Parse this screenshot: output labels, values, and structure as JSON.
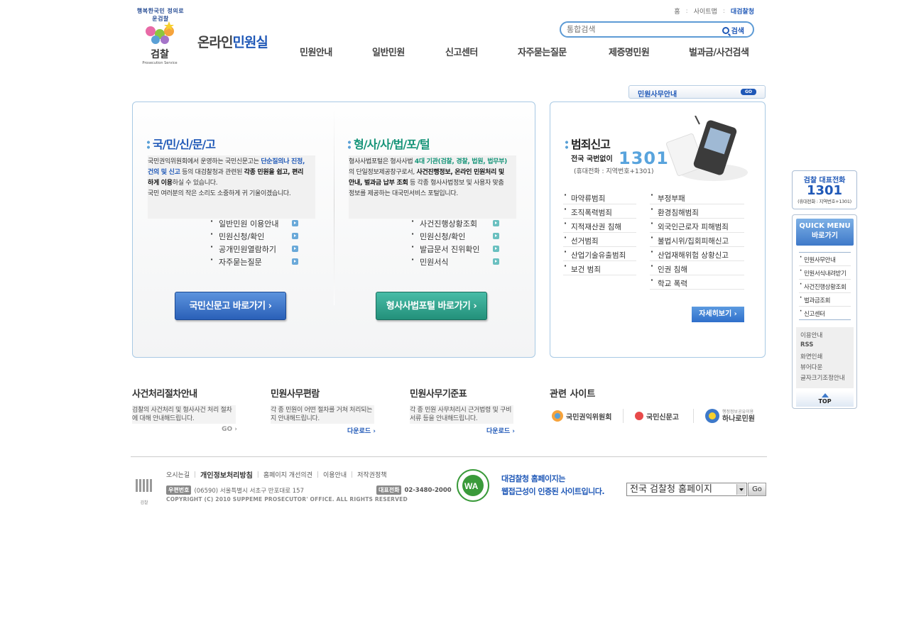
{
  "header": {
    "logo": {
      "ring_text": "행복한국민 정의로운검찰",
      "name": "검찰",
      "eng": "Prosecution Service"
    },
    "title_prefix": "온라인",
    "title_main": "민원실",
    "util": {
      "home": "홈",
      "sitemap": "사이트맵",
      "agency": "대검찰청"
    },
    "search": {
      "placeholder": "통합검색",
      "button": "검색"
    },
    "nav": [
      "민원안내",
      "일반민원",
      "신고센터",
      "자주묻는질문",
      "제증명민원",
      "벌과금/사건검색"
    ]
  },
  "office_bar": {
    "label": "민원사무안내",
    "go": "GO"
  },
  "sinmungo": {
    "title": "국/민/신/문/고",
    "desc_1": "국민권익위원회에서 운영하는 국민신문고는 ",
    "desc_hl1": "단순질의나 진정,",
    "desc_hl2": "건의 및 신고",
    "desc_2": " 등의 대검찰청과 관련된 ",
    "desc_b1": "각종 민원을 쉽고, 편리",
    "desc_b2": "하게 이용",
    "desc_3": "하실 수 있습니다.",
    "desc_4": "국민 여러분의 작은 소리도 소중하게 귀 기울이겠습니다.",
    "links": [
      "일반민원 이용안내",
      "민원신청/확인",
      "공개민원열람하기",
      "자주묻는질문"
    ],
    "button": "국민신문고 바로가기 ›"
  },
  "portal": {
    "title": "형/사/사/법/포/털",
    "desc_1": "형사사법포털은 형사사법 ",
    "desc_g": "4대 기관(검찰, 경찰, 법원, 법무부)",
    "desc_2": "의 단일정보제공창구로서, ",
    "desc_b1": "사건진행정보, 온라인 민원처리 및",
    "desc_b2": "안내, 벌과금 납부 조회",
    "desc_3": " 등 각종 형사사법정보 및 사용자 맞춤",
    "desc_4": "정보를 제공하는 대국민서비스 포털입니다.",
    "links": [
      "사건진행상황조회",
      "민원신청/확인",
      "발급문서 진위확인",
      "민원서식"
    ],
    "button": "형사사법포털 바로가기 ›"
  },
  "report": {
    "title": "범죄신고",
    "subtitle": "전국 국번없이",
    "number": "1301",
    "note": "(휴대전화 : 지역번호+1301)",
    "list_left": [
      "마약류범죄",
      "조직폭력범죄",
      "지적재산권 침해",
      "선거범죄",
      "산업기술유출범죄",
      "보건 범죄"
    ],
    "list_right": [
      "부정부패",
      "환경침해범죄",
      "외국인근로자 피해범죄",
      "불법시위/집회피해신고",
      "산업재해위험 상황신고",
      "인권 침해",
      "학교 폭력"
    ],
    "more": "자세히보기 ›"
  },
  "bottom": {
    "b1": {
      "title": "사건처리절차안내",
      "desc": "검찰의 사건처리 및 형사사건 처리 절차에 대해 안내해드립니다.",
      "link": "GO ›"
    },
    "b2": {
      "title": "민원사무편람",
      "desc": "각 종 민원이 어떤 절차를 거쳐 처리되는지 안내해드립니다.",
      "link": "다운로드 ›"
    },
    "b3": {
      "title": "민원사무기준표",
      "desc": "각 종 민원 사무처리시 근거법령 및 구비서류 등을 안내해드립니다.",
      "link": "다운로드 ›"
    },
    "related": {
      "title": "관련 사이트",
      "sites": [
        "국민권익위원회",
        "국민신문고",
        "하나로민원"
      ],
      "site3_sub": "행정정보공유이용"
    }
  },
  "footer": {
    "logo": "검찰",
    "menu": [
      "오시는길",
      "개인정보처리방침",
      "홈페이지 개선의견",
      "이용안내",
      "저작권정책"
    ],
    "zip_tag": "우편번호",
    "address": "(06590) 서울특별시 서초구 반포대로 157",
    "tel_tag": "대표전화",
    "tel": "02-3480-2000",
    "copyright": "COPYRIGHT (C) 2010  SUPPEME PROSECUTOR' OFFICE. ALL RIGHTS RESERVED",
    "wa_line1": "대검찰청 홈페이지는",
    "wa_line2": "웹접근성이 인증된 사이트입니다.",
    "select": "전국 검찰청 홈페이지",
    "go": "Go"
  },
  "quick": {
    "call_title": "검찰 대표전화",
    "call_number": "1301",
    "call_note": "(휴대전화 : 지역번호+1301)",
    "head_1": "QUICK MENU",
    "head_2": "바로가기",
    "items": [
      "민원사무안내",
      "민원서식내려받기",
      "사건진행상황조회",
      "벌과금조회",
      "신고센터"
    ],
    "tools": [
      "이용안내",
      "RSS",
      "화면인쇄",
      "뷰어다운",
      "글자크기조정안내"
    ],
    "top": "TOP"
  }
}
